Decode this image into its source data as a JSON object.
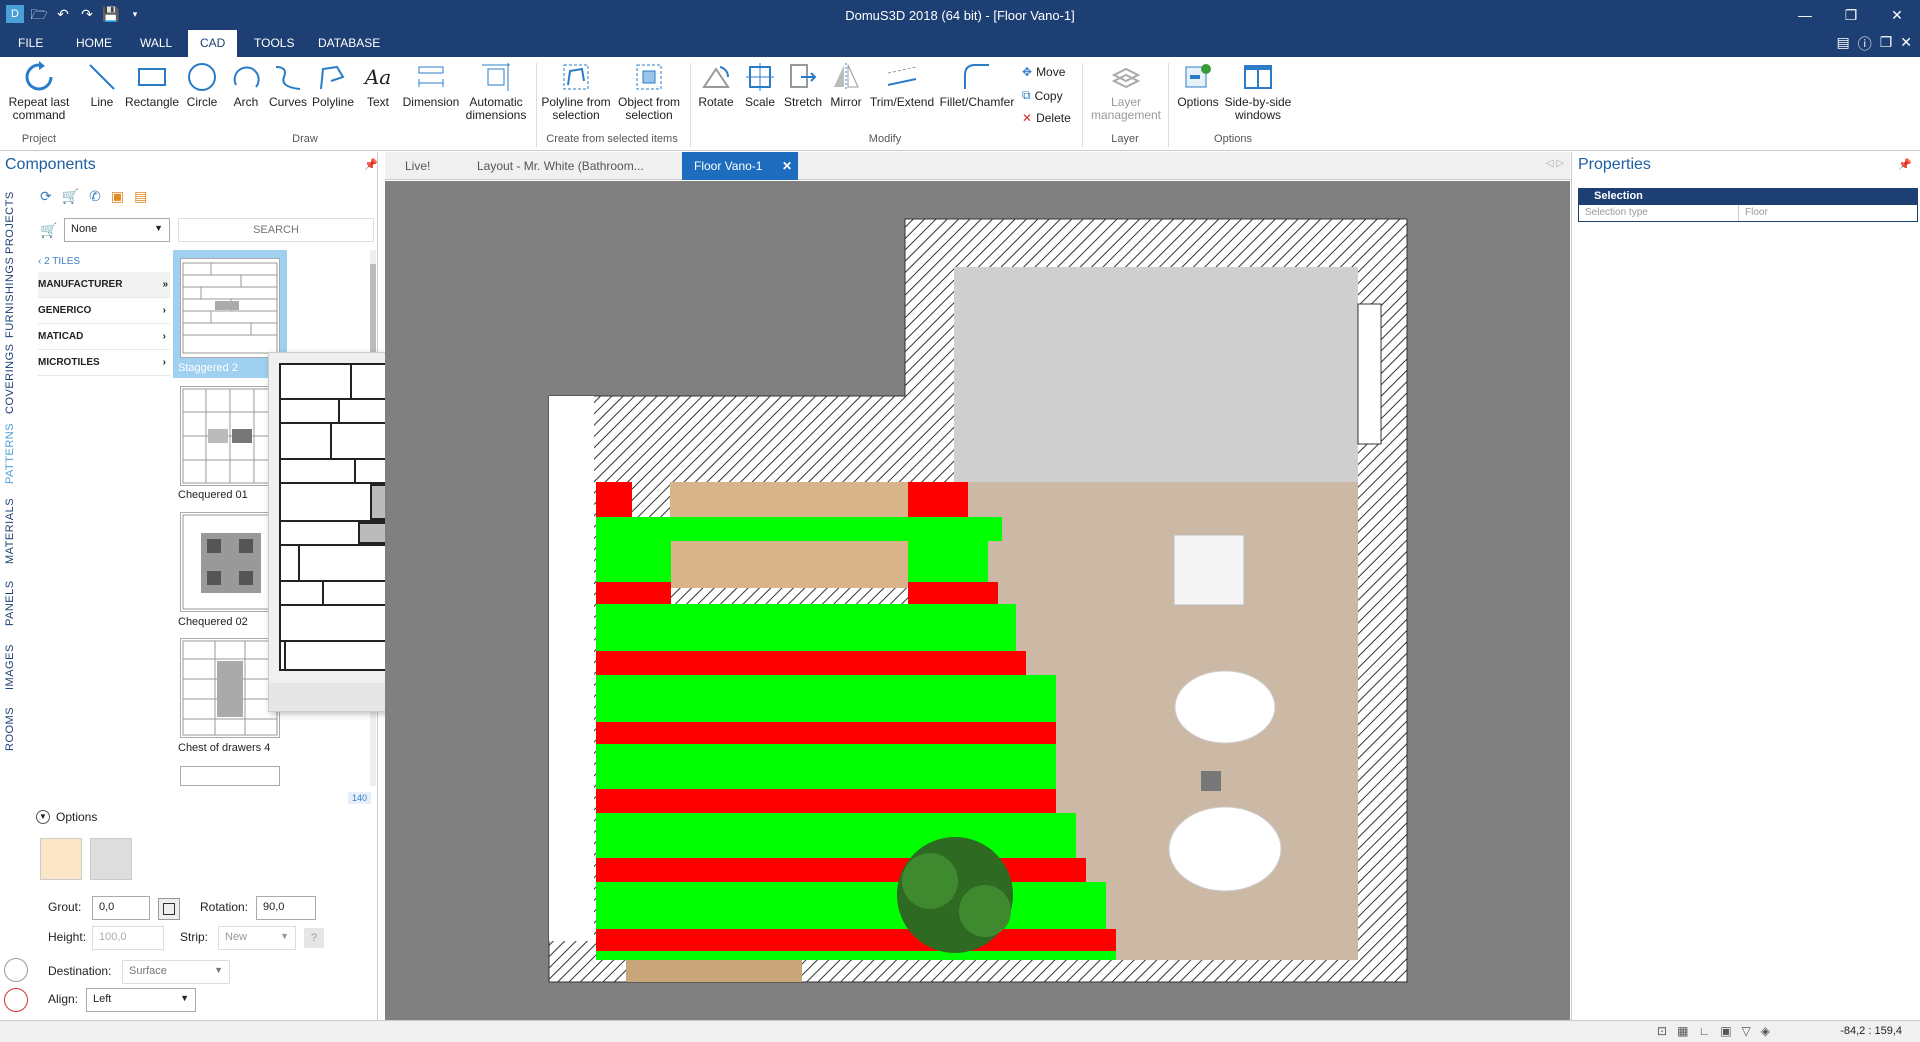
{
  "app": {
    "title": "DomuS3D 2018 (64 bit) - [Floor Vano-1]"
  },
  "menu": {
    "tabs": [
      "FILE",
      "HOME",
      "WALL",
      "CAD",
      "TOOLS",
      "DATABASE"
    ],
    "active": "CAD"
  },
  "ribbon": {
    "repeat_last": "Repeat last command",
    "line": "Line",
    "rectangle": "Rectangle",
    "circle": "Circle",
    "arch": "Arch",
    "curves": "Curves",
    "polyline": "Polyline",
    "text": "Text",
    "dimension": "Dimension",
    "auto_dim": "Automatic dimensions",
    "poly_from_sel": "Polyline from selection",
    "obj_from_sel": "Object from selection",
    "rotate": "Rotate",
    "scale": "Scale",
    "stretch": "Stretch",
    "mirror": "Mirror",
    "trim_extend": "Trim/Extend",
    "fillet": "Fillet/Chamfer",
    "move": "Move",
    "copy": "Copy",
    "delete": "Delete",
    "layer_mgmt": "Layer management",
    "options": "Options",
    "side_by_side": "Side-by-side windows",
    "groups": {
      "project": "Project",
      "draw": "Draw",
      "create": "Create from selected items",
      "modify": "Modify",
      "layer": "Layer",
      "options": "Options"
    }
  },
  "components": {
    "title": "Components",
    "vertical_tabs": [
      "PROJECTS",
      "FURNISHINGS",
      "COVERINGS",
      "PATTERNS",
      "MATERIALS",
      "PANELS",
      "IMAGES",
      "ROOMS"
    ],
    "active_tab": "PATTERNS",
    "filter_value": "None",
    "search_placeholder": "SEARCH",
    "breadcrumb": "2 TILES",
    "categories": [
      "MANUFACTURER",
      "GENERICO",
      "MATICAD",
      "MICROTILES"
    ],
    "patterns": [
      "Staggered 2",
      "Chequered 01",
      "Chequered 02",
      "Chest of drawers 4"
    ],
    "count": "140",
    "preview_title": "Staggered 2",
    "options_label": "Options",
    "grout_label": "Grout:",
    "grout_value": "0,0",
    "rotation_label": "Rotation:",
    "rotation_value": "90,0",
    "height_label": "Height:",
    "height_value": "100,0",
    "strip_label": "Strip:",
    "strip_value": "New",
    "destination_label": "Destination:",
    "destination_value": "Surface",
    "align_label": "Align:",
    "align_value": "Left"
  },
  "doc_tabs": [
    "Live!",
    "Layout - Mr. White (Bathroom...",
    "Floor Vano-1"
  ],
  "active_doc": "Floor Vano-1",
  "properties": {
    "title": "Properties",
    "section": "Selection",
    "col1": "Selection type",
    "col2": "Floor"
  },
  "status": {
    "coords": "-84,2 : 159,4"
  }
}
